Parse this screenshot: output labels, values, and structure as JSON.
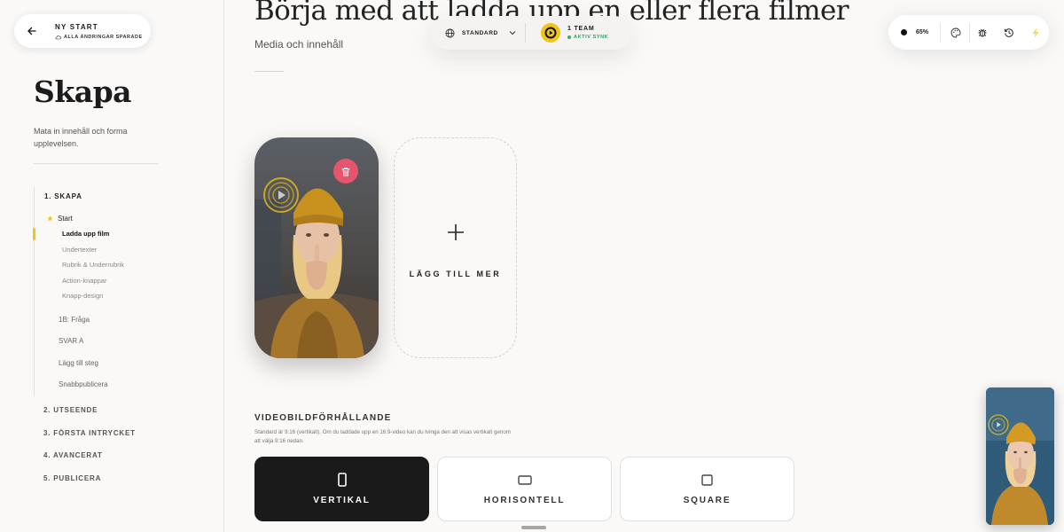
{
  "header": {
    "project_title": "NY START",
    "save_status": "ALLA ÄNDRINGAR SPARADE"
  },
  "sidebar": {
    "title": "Skapa",
    "description": "Mata in innehåll och forma upplevelsen.",
    "section_1": "1. SKAPA",
    "start_label": "Start",
    "sub_items": [
      {
        "label": "Ladda upp film",
        "active": true
      },
      {
        "label": "Undertexter"
      },
      {
        "label": "Rubrik & Underrubrik"
      },
      {
        "label": "Action-knappar"
      },
      {
        "label": "Knapp-design"
      }
    ],
    "items": [
      {
        "label": "1B: Fråga"
      },
      {
        "label": "SVAR A"
      },
      {
        "label": "Lägg till steg"
      },
      {
        "label": "Snabbpublicera"
      }
    ],
    "sections": [
      {
        "label": "2. UTSEENDE"
      },
      {
        "label": "3. FÖRSTA INTRYCKET"
      },
      {
        "label": "4. AVANCERAT"
      },
      {
        "label": "5. PUBLICERA"
      }
    ]
  },
  "main": {
    "title": "Börja med att ladda upp en eller flera filmer",
    "subtitle": "Media och innehåll",
    "add_more_label": "LÄGG TILL MER",
    "aspect": {
      "title": "VIDEOBILDFÖRHÅLLANDE",
      "help": "Standard är 9:16 (vertikalt). Om du laddade upp en 16:9-video kan du tvinga den att visas vertikalt genom att välja 9:16 nedan.",
      "options": [
        {
          "label": "VERTIKAL",
          "selected": true,
          "icon": "portrait-icon"
        },
        {
          "label": "HORISONTELL",
          "selected": false,
          "icon": "landscape-icon"
        },
        {
          "label": "SQUARE",
          "selected": false,
          "icon": "square-icon"
        }
      ]
    }
  },
  "topbar": {
    "language": "STANDARD",
    "team_name": "1 TEAM",
    "sync_status": "AKTIV SYNK"
  },
  "toolbar": {
    "zoom": "65%",
    "icons": [
      "palette-icon",
      "bug-icon",
      "history-icon",
      "lightning-icon"
    ]
  },
  "colors": {
    "accent": "#f0c419",
    "danger": "#e5566c",
    "sync_green": "#2a9d5c",
    "selected_dark": "#1a1a1a"
  }
}
